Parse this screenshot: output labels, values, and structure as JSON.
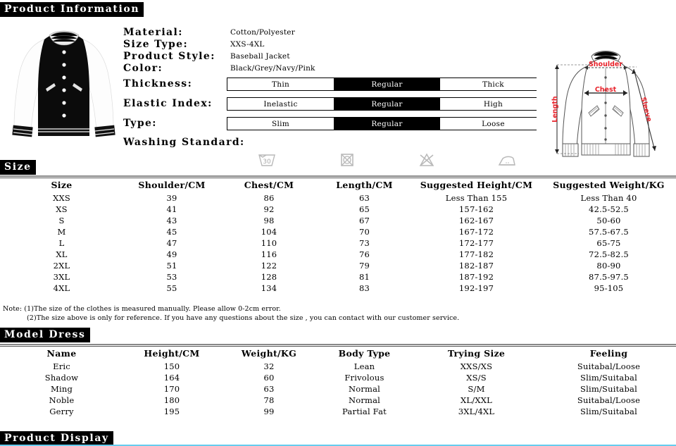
{
  "sections": {
    "product_information": "Product Information",
    "size": "Size",
    "model_dress": "Model Dress",
    "product_display": "Product Display"
  },
  "product_info": {
    "specs": [
      {
        "label": "Material:",
        "value": "Cotton/Polyester"
      },
      {
        "label": "Size Type:",
        "value": "XXS-4XL"
      },
      {
        "label": "Product Style:",
        "value": "Baseball Jacket"
      },
      {
        "label": "Color:",
        "value": "Black/Grey/Navy/Pink"
      }
    ],
    "options": [
      {
        "label": "Thickness:",
        "choices": [
          "Thin",
          "Regular",
          "Thick"
        ],
        "selected": "Regular"
      },
      {
        "label": "Elastic Index:",
        "choices": [
          "Inelastic",
          "Regular",
          "High"
        ],
        "selected": "Regular"
      },
      {
        "label": "Type:",
        "choices": [
          "Slim",
          "Regular",
          "Loose"
        ],
        "selected": "Regular"
      }
    ],
    "washing_label": "Washing Standard:",
    "washing_icons": [
      {
        "name": "wash-30-degrees-icon",
        "text": "30"
      },
      {
        "name": "do-not-tumble-dry-icon",
        "text": ""
      },
      {
        "name": "do-not-bleach-icon",
        "text": ""
      },
      {
        "name": "iron-icon",
        "text": ""
      }
    ],
    "diagram": {
      "shoulder": "Shoulder",
      "chest": "Chest",
      "length": "Length",
      "sleeve": "Sleeve",
      "accent_color": "#e8222a"
    }
  },
  "size_table": {
    "headers": [
      "Size",
      "Shoulder/CM",
      "Chest/CM",
      "Length/CM",
      "Suggested Height/CM",
      "Suggested Weight/KG"
    ],
    "rows": [
      [
        "XXS",
        "39",
        "86",
        "63",
        "Less Than 155",
        "Less Than 40"
      ],
      [
        "XS",
        "41",
        "92",
        "65",
        "157-162",
        "42.5-52.5"
      ],
      [
        "S",
        "43",
        "98",
        "67",
        "162-167",
        "50-60"
      ],
      [
        "M",
        "45",
        "104",
        "70",
        "167-172",
        "57.5-67.5"
      ],
      [
        "L",
        "47",
        "110",
        "73",
        "172-177",
        "65-75"
      ],
      [
        "XL",
        "49",
        "116",
        "76",
        "177-182",
        "72.5-82.5"
      ],
      [
        "2XL",
        "51",
        "122",
        "79",
        "182-187",
        "80-90"
      ],
      [
        "3XL",
        "53",
        "128",
        "81",
        "187-192",
        "87.5-97.5"
      ],
      [
        "4XL",
        "55",
        "134",
        "83",
        "192-197",
        "95-105"
      ]
    ],
    "note_line1": "Note: (1)The size of the clothes is measured manually. Please allow 0-2cm error.",
    "note_line2": "(2)The size above is only for reference. If you have any questions about the size , you can contact with our customer service."
  },
  "model_table": {
    "headers": [
      "Name",
      "Height/CM",
      "Weight/KG",
      "Body Type",
      "Trying Size",
      "Feeling"
    ],
    "rows": [
      [
        "Eric",
        "150",
        "32",
        "Lean",
        "XXS/XS",
        "Suitabal/Loose"
      ],
      [
        "Shadow",
        "164",
        "60",
        "Frivolous",
        "XS/S",
        "Slim/Suitabal"
      ],
      [
        "Ming",
        "170",
        "63",
        "Normal",
        "S/M",
        "Slim/Suitabal"
      ],
      [
        "Noble",
        "180",
        "78",
        "Normal",
        "XL/XXL",
        "Suitabal/Loose"
      ],
      [
        "Gerry",
        "195",
        "99",
        "Partial Fat",
        "3XL/4XL",
        "Slim/Suitabal"
      ]
    ]
  }
}
